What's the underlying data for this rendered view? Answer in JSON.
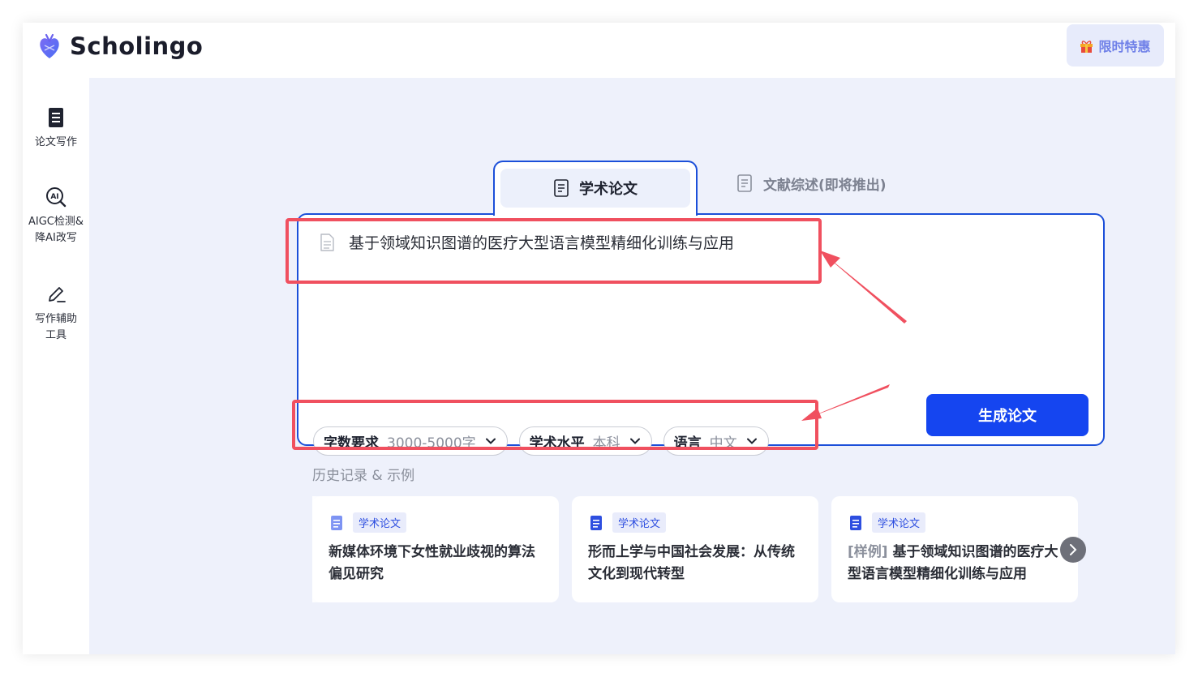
{
  "app": {
    "name": "Scholingo",
    "promo_label": "限时特惠"
  },
  "sidebar": {
    "items": [
      {
        "label": "论文写作",
        "icon": "document-icon"
      },
      {
        "label": "AIGC检测&\n降AI改写",
        "icon": "ai-search-icon"
      },
      {
        "label": "写作辅助\n工具",
        "icon": "pen-icon"
      }
    ]
  },
  "tabs": [
    {
      "label": "学术论文",
      "active": true
    },
    {
      "label": "文献综述(即将推出)",
      "active": false
    }
  ],
  "composer": {
    "topic": "基于领域知识图谱的医疗大型语言模型精细化训练与应用",
    "options": [
      {
        "key": "字数要求",
        "value": "3000-5000字"
      },
      {
        "key": "学术水平",
        "value": "本科"
      },
      {
        "key": "语言",
        "value": "中文"
      }
    ],
    "generate_label": "生成论文"
  },
  "history": {
    "title": "历史记录 & 示例",
    "cards": [
      {
        "badge": "学术论文",
        "prefix": "",
        "title": "新媒体环境下女性就业歧视的算法偏见研究"
      },
      {
        "badge": "学术论文",
        "prefix": "",
        "title": "形而上学与中国社会发展：从传统文化到现代转型"
      },
      {
        "badge": "学术论文",
        "prefix": "[样例] ",
        "title": "基于领域知识图谱的医疗大型语言模型精细化训练与应用"
      }
    ]
  },
  "colors": {
    "accent": "#1545f0",
    "tab_border": "#1b4fd9",
    "annotation": "#f0505f",
    "background": "#eef1fb"
  }
}
